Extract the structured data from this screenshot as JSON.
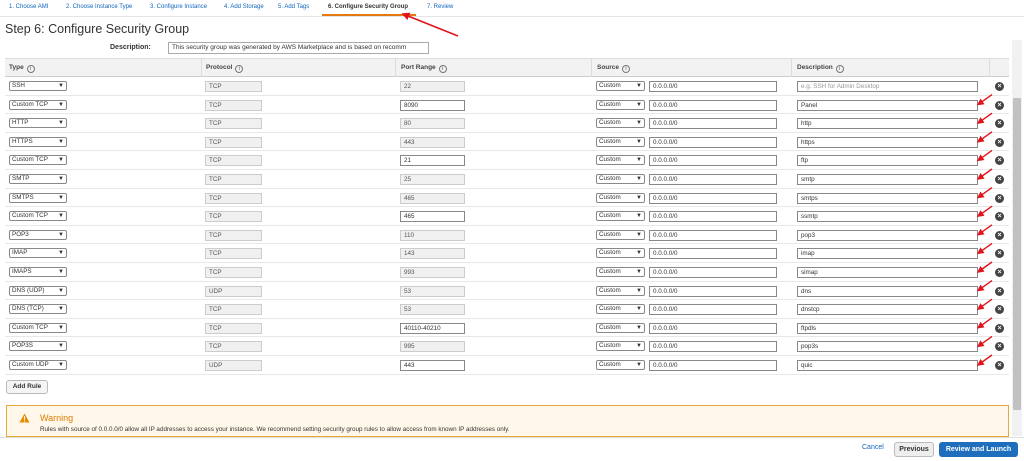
{
  "steps": [
    {
      "label": "1. Choose AMI"
    },
    {
      "label": "2. Choose Instance Type"
    },
    {
      "label": "3. Configure Instance"
    },
    {
      "label": "4. Add Storage"
    },
    {
      "label": "5. Add Tags"
    },
    {
      "label": "6. Configure Security Group"
    },
    {
      "label": "7. Review"
    }
  ],
  "page_title": "Step 6: Configure Security Group",
  "description": {
    "label": "Description:",
    "value": "This security group was generated by AWS Marketplace and is based on recomm"
  },
  "table": {
    "headers": {
      "type": "Type",
      "protocol": "Protocol",
      "port_range": "Port Range",
      "source": "Source",
      "description": "Description"
    },
    "info_glyph": "i",
    "rows": [
      {
        "type": "SSH",
        "protocol": "TCP",
        "port": "22",
        "source": "Custom",
        "cidr": "0.0.0.0/0",
        "desc": "",
        "desc_placeholder": "e.g. SSH for Admin Desktop"
      },
      {
        "type": "Custom TCP",
        "protocol": "TCP",
        "port": "8090",
        "source": "Custom",
        "cidr": "0.0.0.0/0",
        "desc": "Panel"
      },
      {
        "type": "HTTP",
        "protocol": "TCP",
        "port": "80",
        "source": "Custom",
        "cidr": "0.0.0.0/0",
        "desc": "http"
      },
      {
        "type": "HTTPS",
        "protocol": "TCP",
        "port": "443",
        "source": "Custom",
        "cidr": "0.0.0.0/0",
        "desc": "https"
      },
      {
        "type": "Custom TCP",
        "protocol": "TCP",
        "port": "21",
        "source": "Custom",
        "cidr": "0.0.0.0/0",
        "desc": "ftp"
      },
      {
        "type": "SMTP",
        "protocol": "TCP",
        "port": "25",
        "source": "Custom",
        "cidr": "0.0.0.0/0",
        "desc": "smtp"
      },
      {
        "type": "SMTPS",
        "protocol": "TCP",
        "port": "465",
        "source": "Custom",
        "cidr": "0.0.0.0/0",
        "desc": "smtps"
      },
      {
        "type": "Custom TCP",
        "protocol": "TCP",
        "port": "465",
        "source": "Custom",
        "cidr": "0.0.0.0/0",
        "desc": "ssmtp"
      },
      {
        "type": "POP3",
        "protocol": "TCP",
        "port": "110",
        "source": "Custom",
        "cidr": "0.0.0.0/0",
        "desc": "pop3"
      },
      {
        "type": "IMAP",
        "protocol": "TCP",
        "port": "143",
        "source": "Custom",
        "cidr": "0.0.0.0/0",
        "desc": "imap"
      },
      {
        "type": "IMAPS",
        "protocol": "TCP",
        "port": "993",
        "source": "Custom",
        "cidr": "0.0.0.0/0",
        "desc": "simap"
      },
      {
        "type": "DNS (UDP)",
        "protocol": "UDP",
        "port": "53",
        "source": "Custom",
        "cidr": "0.0.0.0/0",
        "desc": "dns"
      },
      {
        "type": "DNS (TCP)",
        "protocol": "TCP",
        "port": "53",
        "source": "Custom",
        "cidr": "0.0.0.0/0",
        "desc": "dnstcp"
      },
      {
        "type": "Custom TCP",
        "protocol": "TCP",
        "port": "40110-40210",
        "source": "Custom",
        "cidr": "0.0.0.0/0",
        "desc": "ftpdls"
      },
      {
        "type": "POP3S",
        "protocol": "TCP",
        "port": "995",
        "source": "Custom",
        "cidr": "0.0.0.0/0",
        "desc": "pop3s"
      },
      {
        "type": "Custom UDP",
        "protocol": "UDP",
        "port": "443",
        "source": "Custom",
        "cidr": "0.0.0.0/0",
        "desc": "quic"
      }
    ]
  },
  "add_rule_label": "Add Rule",
  "warning": {
    "title": "Warning",
    "text": "Rules with source of 0.0.0.0/0 allow all IP addresses to access your instance. We recommend setting security group rules to allow access from known IP addresses only."
  },
  "footer": {
    "cancel": "Cancel",
    "previous": "Previous",
    "review_launch": "Review and Launch"
  },
  "icons": {
    "delete": "close-circle-icon",
    "warning": "warning-triangle-icon",
    "dropdown": "chevron-down-icon",
    "info": "info-icon"
  },
  "colors": {
    "link": "#1166bb",
    "active_step": "#e47911",
    "primary_button": "#1f6ebd",
    "warning_border": "#e7a93a",
    "annotation": "#e0141c"
  }
}
